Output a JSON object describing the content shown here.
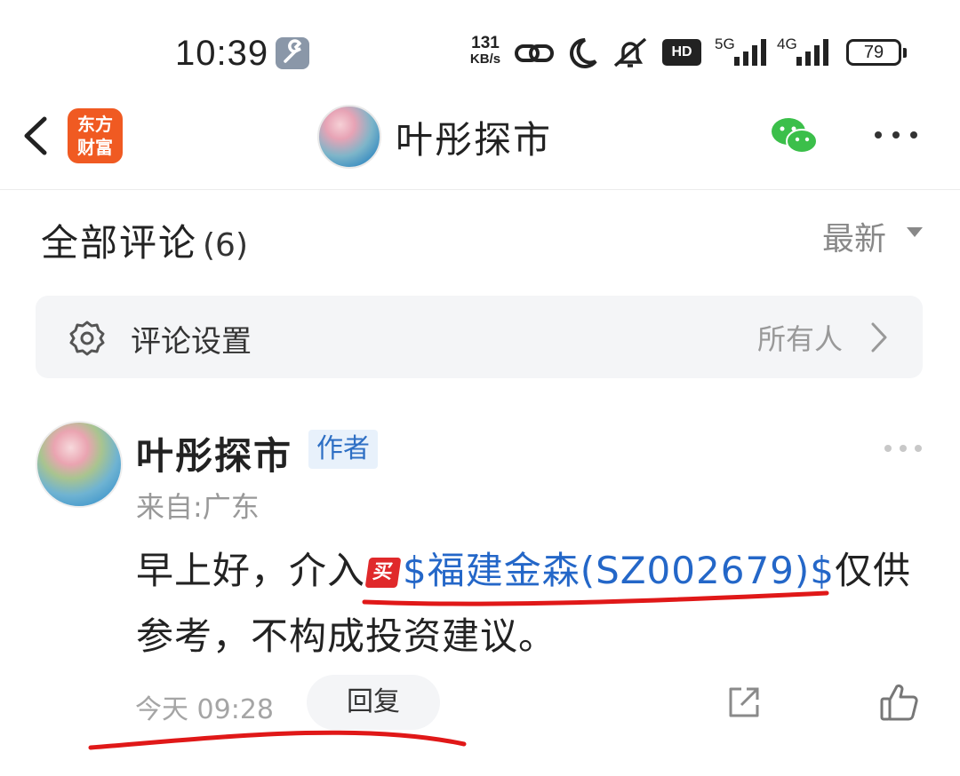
{
  "status_bar": {
    "time": "10:39",
    "net_speed_value": "131",
    "net_speed_unit": "KB/s",
    "hd_label": "HD",
    "sim1_type": "5G",
    "sim2_type": "4G",
    "battery": "79",
    "icons": [
      "wrench-icon",
      "link-icon",
      "moon-icon",
      "mute-icon",
      "hd-icon",
      "signal-icon",
      "battery-icon"
    ]
  },
  "header": {
    "app_logo_line1": "东方",
    "app_logo_line2": "财富",
    "title": "叶彤探市",
    "colors": {
      "logo": "#f05a22",
      "wechat": "#3bbf4a"
    }
  },
  "comments_section": {
    "title": "全部评论",
    "count": "(6)",
    "sort_label": "最新"
  },
  "settings": {
    "label": "评论设置",
    "value": "所有人"
  },
  "comment": {
    "author": "叶彤探市",
    "badge": "作者",
    "location": "来自:广东",
    "text_before": "早上好，介入",
    "buy_marker": "买",
    "stock_link": "$福建金森(SZ002679)$",
    "text_after": "仅供参考，不构成投资建议。",
    "time": "今天 09:28",
    "reply_label": "回复",
    "colors": {
      "link": "#2467c8",
      "buy_marker": "#e0292b",
      "badge_bg": "#e8f1fb",
      "badge_text": "#2e6fc4"
    }
  }
}
